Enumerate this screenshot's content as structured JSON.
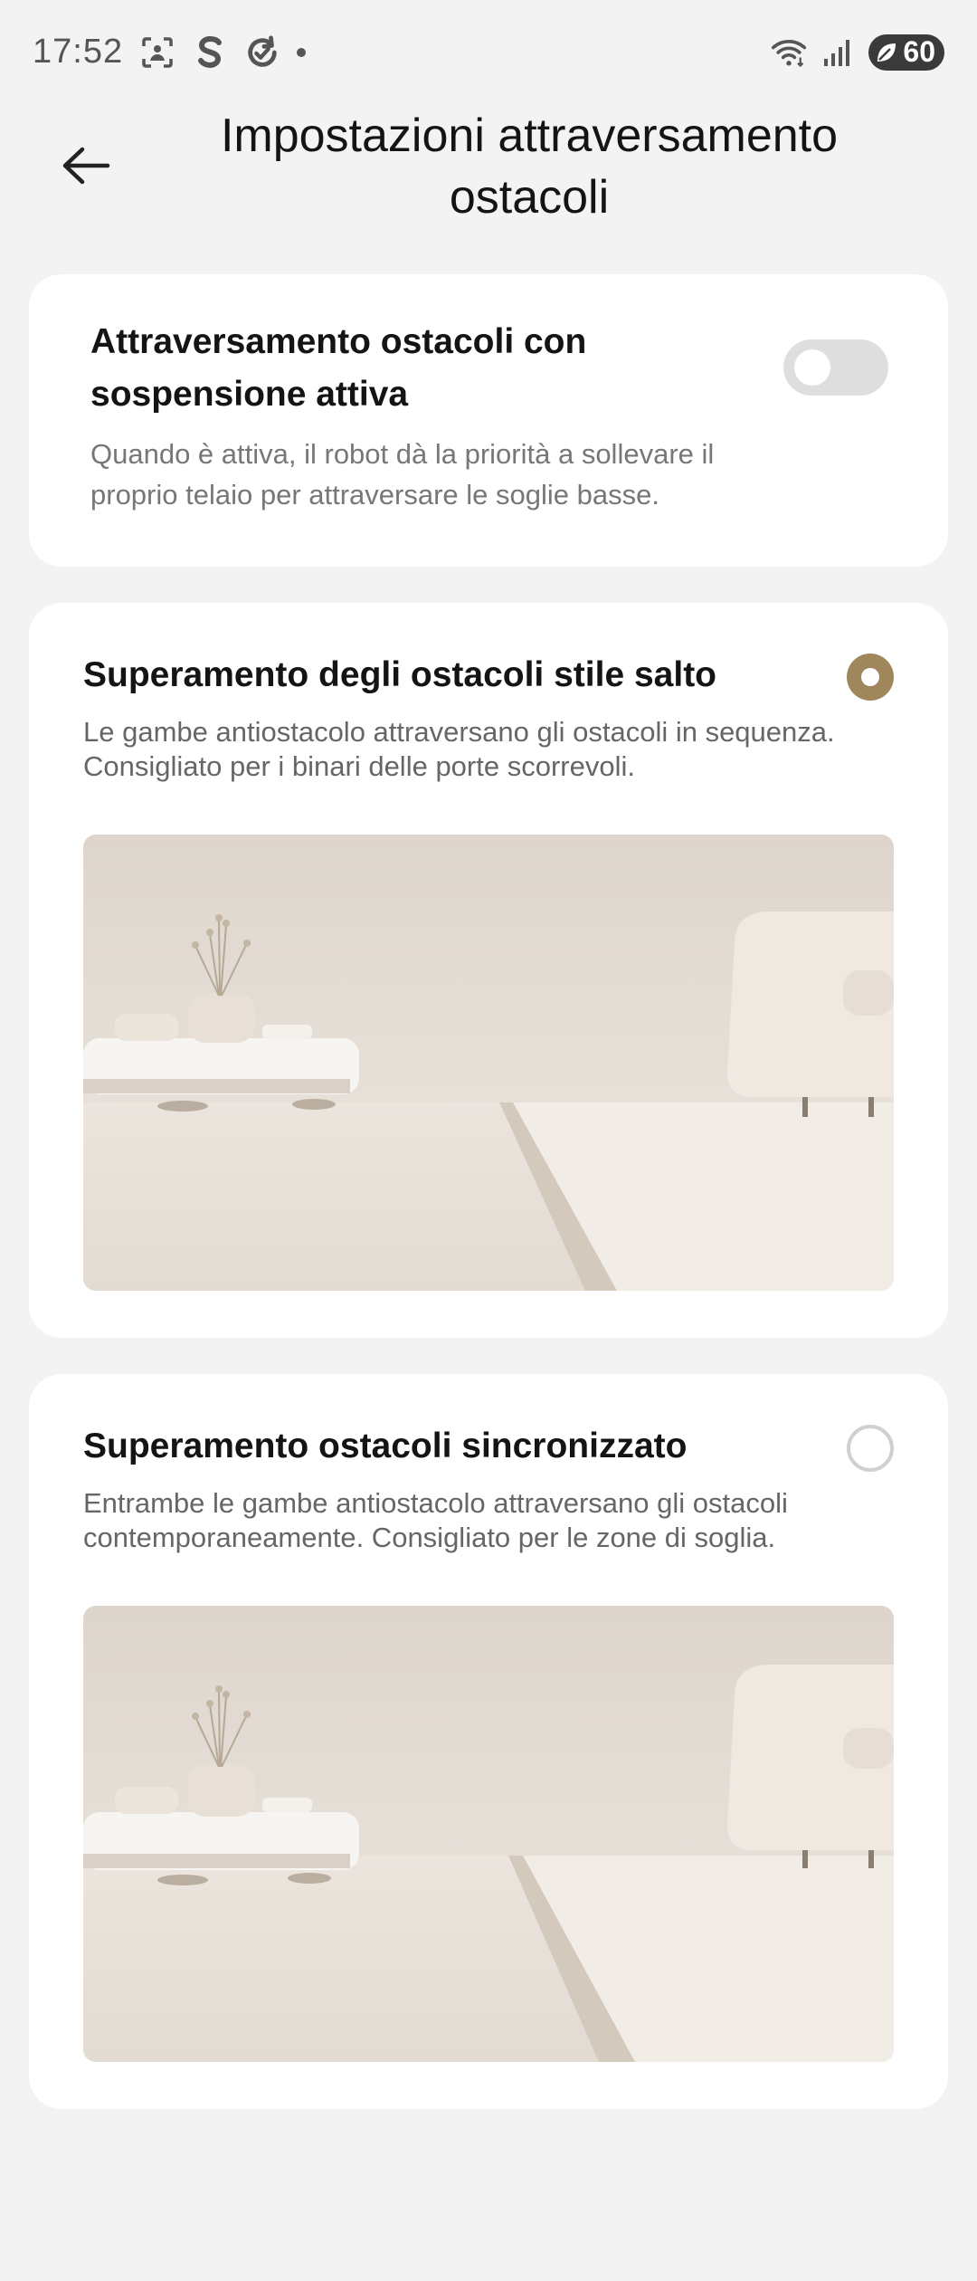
{
  "status_bar": {
    "time": "17:52",
    "battery": "60",
    "icons": [
      "screenshot-icon",
      "s-app-icon",
      "sync-icon",
      "dot-icon",
      "wifi-icon",
      "signal-icon",
      "battery-icon"
    ]
  },
  "header": {
    "title": "Impostazioni attraversamento ostacoli",
    "back_icon": "back-arrow-icon"
  },
  "active_suspension": {
    "title": "Attraversamento ostacoli con sospensione attiva",
    "description": "Quando è attiva, il robot dà la priorità a sollevare il proprio telaio per attraversare le soglie basse.",
    "enabled": false
  },
  "options": [
    {
      "title": "Superamento degli ostacoli stile salto",
      "description": "Le gambe antiostacolo attraversano gli ostacoli in sequenza. Consigliato per i binari delle porte scorrevoli.",
      "selected": true
    },
    {
      "title": "Superamento ostacoli sincronizzato",
      "description": "Entrambe le gambe antiostacolo attraversano gli ostacoli contemporaneamente. Consigliato per le zone di soglia.",
      "selected": false
    }
  ],
  "colors": {
    "background": "#f3f3f3",
    "card": "#ffffff",
    "accent": "#a0865b",
    "toggle_off": "#dedede",
    "radio_off": "#d0d0d0"
  }
}
